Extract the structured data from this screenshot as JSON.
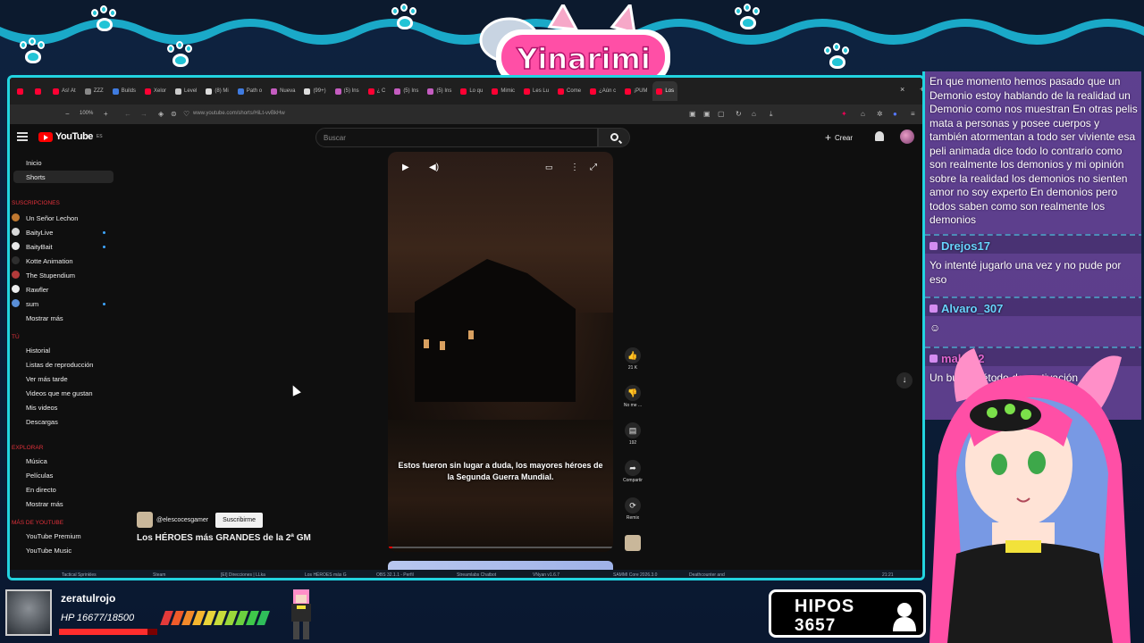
{
  "stream": {
    "brand": "Yinarimi",
    "colors": {
      "accent": "#22d4e0",
      "brand_pink": "#ff4fa6",
      "chat_bg": "#a05ad2"
    }
  },
  "browser": {
    "tabs": [
      {
        "label": "",
        "color": "#ff0033"
      },
      {
        "label": "",
        "color": "#ff0033"
      },
      {
        "label": "As! At",
        "color": "#ff0033"
      },
      {
        "label": "ZZZ",
        "color": "#888888"
      },
      {
        "label": "Builds",
        "color": "#3f7be0"
      },
      {
        "label": "Xelor",
        "color": "#ff0033"
      },
      {
        "label": "Level",
        "color": "#cccccc"
      },
      {
        "label": "(8) Mi",
        "color": "#dddddd"
      },
      {
        "label": "Path o",
        "color": "#3f7be0"
      },
      {
        "label": "Nueva",
        "color": "#c45cc0"
      },
      {
        "label": "(99+)",
        "color": "#dddddd"
      },
      {
        "label": "(5) Ins",
        "color": "#c45cc0"
      },
      {
        "label": "¿ C",
        "color": "#ff0033"
      },
      {
        "label": "(5) Ins",
        "color": "#c45cc0"
      },
      {
        "label": "(5) Ins",
        "color": "#c45cc0"
      },
      {
        "label": "Lo qu",
        "color": "#ff0033"
      },
      {
        "label": "Mimic",
        "color": "#ff0033"
      },
      {
        "label": "Les Lu",
        "color": "#ff0033"
      },
      {
        "label": "Come",
        "color": "#ff0033"
      },
      {
        "label": "¿Aún c",
        "color": "#ff0033"
      },
      {
        "label": "¡PUM",
        "color": "#ff0033"
      },
      {
        "label": "Los",
        "color": "#ff0033",
        "active": true
      }
    ],
    "close_tab": "×",
    "new_tab": "+",
    "zoom": "100%",
    "zoom_minus": "−",
    "zoom_plus": "+",
    "url": "www.youtube.com/shorts/HiLt-vvBkHw"
  },
  "youtube": {
    "logo": "YouTube",
    "logo_country": "ES",
    "search_placeholder": "Buscar",
    "create_label": "Crear",
    "sidebar": {
      "top": [
        {
          "label": "Inicio"
        },
        {
          "label": "Shorts",
          "selected": true
        }
      ],
      "subs_heading": "SUSCRIPCIONES",
      "subs": [
        {
          "label": "Un Señor Lechon",
          "color": "#c07830",
          "dot": false
        },
        {
          "label": "BaityLive",
          "color": "#d8d8d8",
          "dot": true
        },
        {
          "label": "BaityBait",
          "color": "#e8e8e8",
          "dot": true
        },
        {
          "label": "Kotte Animation",
          "color": "#2e2e2e",
          "dot": false
        },
        {
          "label": "The Stupendium",
          "color": "#b33a3a",
          "dot": false
        },
        {
          "label": "Rawfler",
          "color": "#eeeeee",
          "dot": false
        },
        {
          "label": "sum",
          "color": "#5a8fd8",
          "dot": true
        }
      ],
      "show_more_1": "Mostrar más",
      "you_heading": "TÚ",
      "you": [
        {
          "label": "Historial"
        },
        {
          "label": "Listas de reproducción"
        },
        {
          "label": "Ver más tarde"
        },
        {
          "label": "Videos que me gustan"
        },
        {
          "label": "Mis videos"
        },
        {
          "label": "Descargas"
        }
      ],
      "explore_heading": "EXPLORAR",
      "explore": [
        {
          "label": "Música"
        },
        {
          "label": "Películas"
        },
        {
          "label": "En directo"
        }
      ],
      "show_more_2": "Mostrar más",
      "more_heading": "MÁS DE YOUTUBE",
      "more": [
        {
          "label": "YouTube Premium"
        },
        {
          "label": "YouTube Music"
        }
      ]
    },
    "short": {
      "caption": "Estos fueron sin lugar a duda, los mayores héroes de la Segunda Guerra Mundial.",
      "progress": 0.02,
      "channel": "@elescocesgamer",
      "subscribe": "Suscribirme",
      "title": "Los HÉROES más GRANDES de la 2ª GM",
      "actions": [
        {
          "icon": "like-icon",
          "glyph": "👍",
          "label": "21 K"
        },
        {
          "icon": "dislike-icon",
          "glyph": "👎",
          "label": "No me ..."
        },
        {
          "icon": "comment-icon",
          "glyph": "▤",
          "label": "192"
        },
        {
          "icon": "share-icon",
          "glyph": "➦",
          "label": "Compartir"
        },
        {
          "icon": "remix-icon",
          "glyph": "⟳",
          "label": "Remix"
        }
      ]
    }
  },
  "taskbar": {
    "items": [
      "Tactical Sprinkles",
      "Steam",
      "[EI] Direcciones | LLka",
      "Los HÉROES más G",
      "OBS 32.1.1 - Perfil",
      "Streamlabs Chatbot",
      "VNyan v1.6.7",
      "SAMMI Core 2026.3.0",
      "Deathcounter and"
    ],
    "clock": "21:21"
  },
  "chat": {
    "top_message": "En que momento hemos pasado que un Demonio estoy hablando de la realidad un Demonio como nos muestran En otras pelis mata a personas y posee cuerpos y también atormentan a todo ser viviente esa peli animada dice todo lo contrario como son realmente los demonios y mi opinión sobre la realidad los demonios no sienten amor no soy experto En demonios pero todos saben como son realmente los demonios",
    "messages": [
      {
        "user": "Drejos17",
        "text": "Yo intenté jugarlo una vez y no pude por eso"
      },
      {
        "user": "Alvaro_307",
        "text": ""
      },
      {
        "user": "maku22",
        "text": "Un buen método de motivación"
      }
    ]
  },
  "hud": {
    "player": "zeratulrojo",
    "hp_text": "HP 16677/18500",
    "hp_fraction": 0.9015,
    "segment_colors": [
      "#e33a3a",
      "#ef5b2a",
      "#f2892a",
      "#f5b52f",
      "#e9d43a",
      "#c8dc3a",
      "#9bd83a",
      "#6bd13f",
      "#3fc94a",
      "#2fbd5a"
    ],
    "hipos_label": "HIPOS",
    "hipos_count": "3657"
  }
}
